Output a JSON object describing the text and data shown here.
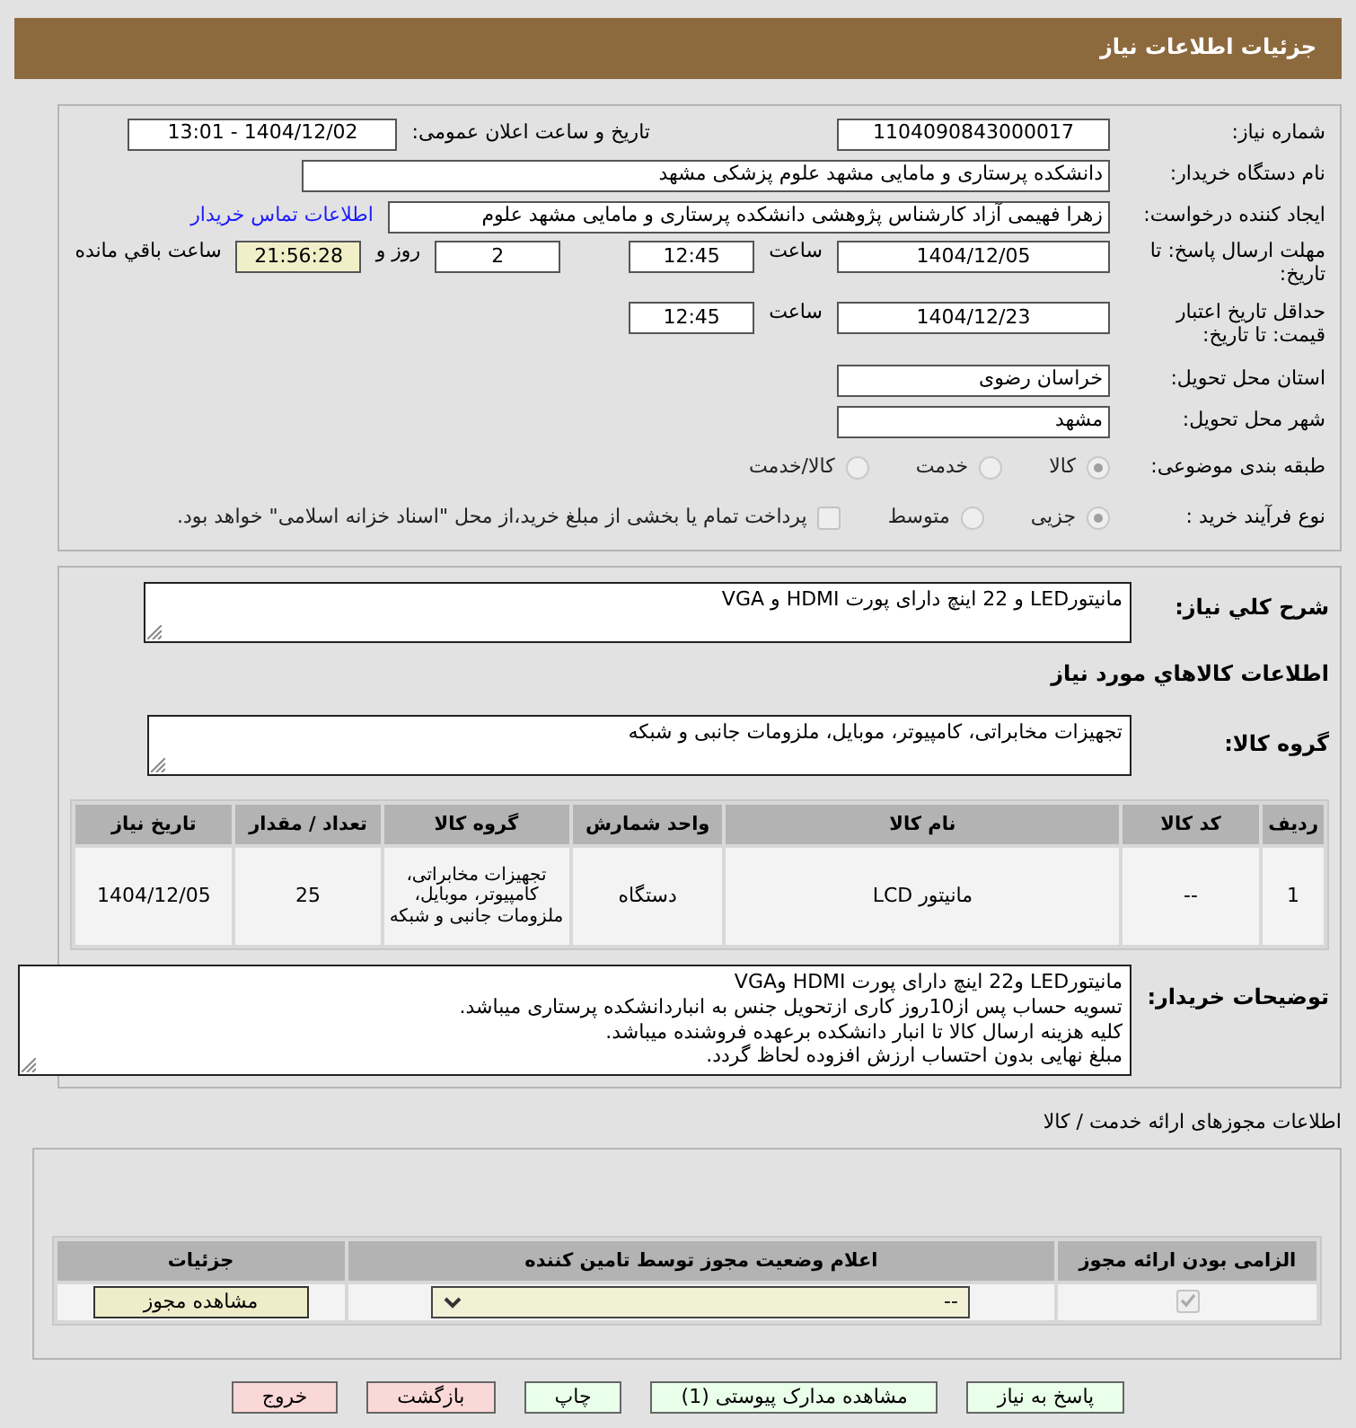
{
  "header": {
    "title": "جزئیات اطلاعات نیاز"
  },
  "need_number": {
    "label": "شماره نیاز:",
    "value": "1104090843000017"
  },
  "announce": {
    "label": "تاریخ و ساعت اعلان عمومی:",
    "value": "1404/12/02 - 13:01"
  },
  "buyer_org": {
    "label": "نام دستگاه خریدار:",
    "value": "دانشکده پرستاری و مامایی مشهد   علوم پزشکی مشهد"
  },
  "requester": {
    "label": "ایجاد کننده درخواست:",
    "value": "زهرا فهیمی آزاد کارشناس پژوهشی دانشکده پرستاری و مامایی مشهد   علوم",
    "link": "اطلاعات تماس خریدار"
  },
  "reply_deadline": {
    "label": "مهلت ارسال پاسخ: تا تاریخ:",
    "date": "1404/12/05",
    "time_label": "ساعت",
    "time": "12:45",
    "days": "2",
    "days_label": "روز و",
    "remaining": "21:56:28",
    "remaining_label": "ساعت باقي مانده"
  },
  "price_validity": {
    "label": "حداقل تاریخ اعتبار قیمت: تا تاریخ:",
    "date": "1404/12/23",
    "time_label": "ساعت",
    "time": "12:45"
  },
  "province": {
    "label": "استان محل تحویل:",
    "value": "خراسان رضوی"
  },
  "city": {
    "label": "شهر محل تحویل:",
    "value": "مشهد"
  },
  "category": {
    "label": "طبقه بندی موضوعی:",
    "options": [
      {
        "label": "کالا",
        "selected": true
      },
      {
        "label": "خدمت",
        "selected": false
      },
      {
        "label": "کالا/خدمت",
        "selected": false
      }
    ]
  },
  "process": {
    "label": "نوع فرآیند خرید :",
    "options": [
      {
        "label": "جزیی",
        "selected": true
      },
      {
        "label": "متوسط",
        "selected": false
      }
    ],
    "payment": {
      "label": "پرداخت تمام یا بخشی از مبلغ خرید،از محل \"اسناد خزانه اسلامی\" خواهد بود.",
      "checked": false
    }
  },
  "description": {
    "label": "شرح کلي نیاز:",
    "value": "مانیتورLED و 22 اینچ دارای پورت HDMI و VGA"
  },
  "goods_title": "اطلاعات کالاهاي مورد نياز",
  "goods_group": {
    "label": "گروه کالا:",
    "value": "تجهیزات مخابراتی، کامپیوتر، موبایل، ملزومات جانبی و شبکه"
  },
  "goods_table": {
    "columns": [
      "ردیف",
      "کد کالا",
      "نام کالا",
      "واحد شمارش",
      "گروه کالا",
      "تعداد / مقدار",
      "تاریخ نیاز"
    ],
    "rows": [
      [
        "1",
        "--",
        "مانیتور LCD",
        "دستگاه",
        "تجهیزات مخابراتی، کامپیوتر، موبایل، ملزومات جانبی و شبکه",
        "25",
        "1404/12/05"
      ]
    ]
  },
  "buyer_notes": {
    "label": "توضیحات خریدار:",
    "lines": [
      "مانیتورLED و22 اینچ دارای پورت HDMI وVGA",
      "تسویه حساب پس از10روز کاری ازتحویل جنس به انباردانشکده پرستاری میباشد.",
      "کلیه هزینه ارسال کالا تا انبار دانشکده برعهده فروشنده میباشد.",
      "مبلغ نهایی بدون احتساب ارزش افزوده لحاظ گردد."
    ]
  },
  "licenses": {
    "title": "اطلاعات مجوزهای ارائه خدمت / کالا",
    "columns": [
      "الزامی بودن ارائه مجوز",
      "اعلام وضعیت مجوز توسط تامین کننده",
      "جزئیات"
    ],
    "rows": [
      {
        "required": true,
        "status": "--",
        "action": "مشاهده مجوز"
      }
    ]
  },
  "buttons": [
    {
      "label": "پاسخ به نیاز",
      "kind": "normal"
    },
    {
      "label": "مشاهده مدارک پیوستی (1)",
      "kind": "normal"
    },
    {
      "label": "چاپ",
      "kind": "normal"
    },
    {
      "label": "بازگشت",
      "kind": "danger"
    },
    {
      "label": "خروج",
      "kind": "danger"
    }
  ]
}
